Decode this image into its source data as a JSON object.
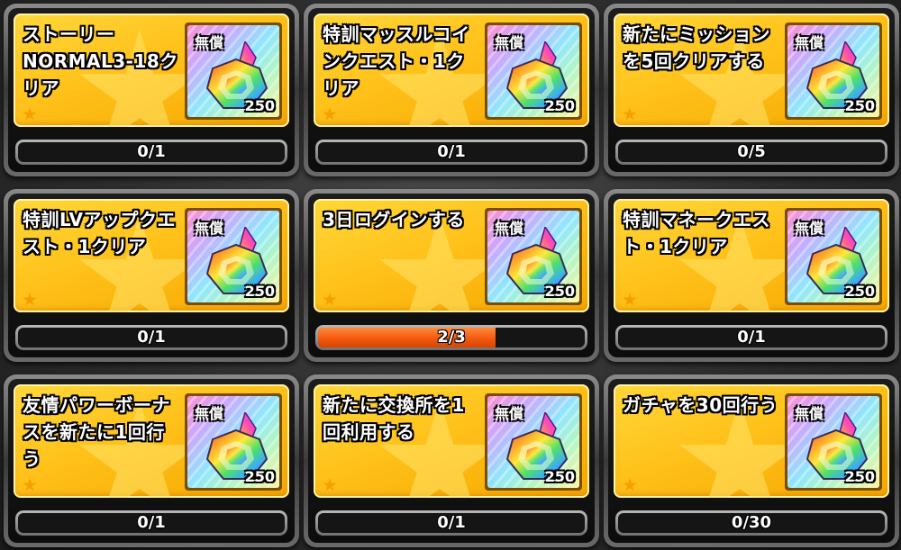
{
  "missions": [
    {
      "text": "ストーリーNORMAL3-18クリア",
      "reward_label": "無償",
      "reward_count": "250",
      "reward_icon": "rainbow-gem-icon",
      "progress": "0/1",
      "progress_fraction": 0
    },
    {
      "text": "特訓マッスルコインクエスト・1クリア",
      "reward_label": "無償",
      "reward_count": "250",
      "reward_icon": "rainbow-gem-icon",
      "progress": "0/1",
      "progress_fraction": 0
    },
    {
      "text": "新たにミッションを5回クリアする",
      "reward_label": "無償",
      "reward_count": "250",
      "reward_icon": "rainbow-gem-icon",
      "progress": "0/5",
      "progress_fraction": 0
    },
    {
      "text": "特訓LVアップクエスト・1クリア",
      "reward_label": "無償",
      "reward_count": "250",
      "reward_icon": "rainbow-gem-icon",
      "progress": "0/1",
      "progress_fraction": 0
    },
    {
      "text": "3日ログインする",
      "reward_label": "無償",
      "reward_count": "250",
      "reward_icon": "rainbow-gem-icon",
      "progress": "2/3",
      "progress_fraction": 0.667
    },
    {
      "text": "特訓マネークエスト・1クリア",
      "reward_label": "無償",
      "reward_count": "250",
      "reward_icon": "rainbow-gem-icon",
      "progress": "0/1",
      "progress_fraction": 0
    },
    {
      "text": "友情パワーボーナスを新たに1回行う",
      "reward_label": "無償",
      "reward_count": "250",
      "reward_icon": "rainbow-gem-icon",
      "progress": "0/1",
      "progress_fraction": 0
    },
    {
      "text": "新たに交換所を1回利用する",
      "reward_label": "無償",
      "reward_count": "250",
      "reward_icon": "rainbow-gem-icon",
      "progress": "0/1",
      "progress_fraction": 0
    },
    {
      "text": "ガチャを30回行う",
      "reward_label": "無償",
      "reward_count": "250",
      "reward_icon": "rainbow-gem-icon",
      "progress": "0/30",
      "progress_fraction": 0
    }
  ],
  "colors": {
    "panel": "#ffc11a",
    "progress_fill": "#f45a10",
    "bar_track": "#151515"
  }
}
